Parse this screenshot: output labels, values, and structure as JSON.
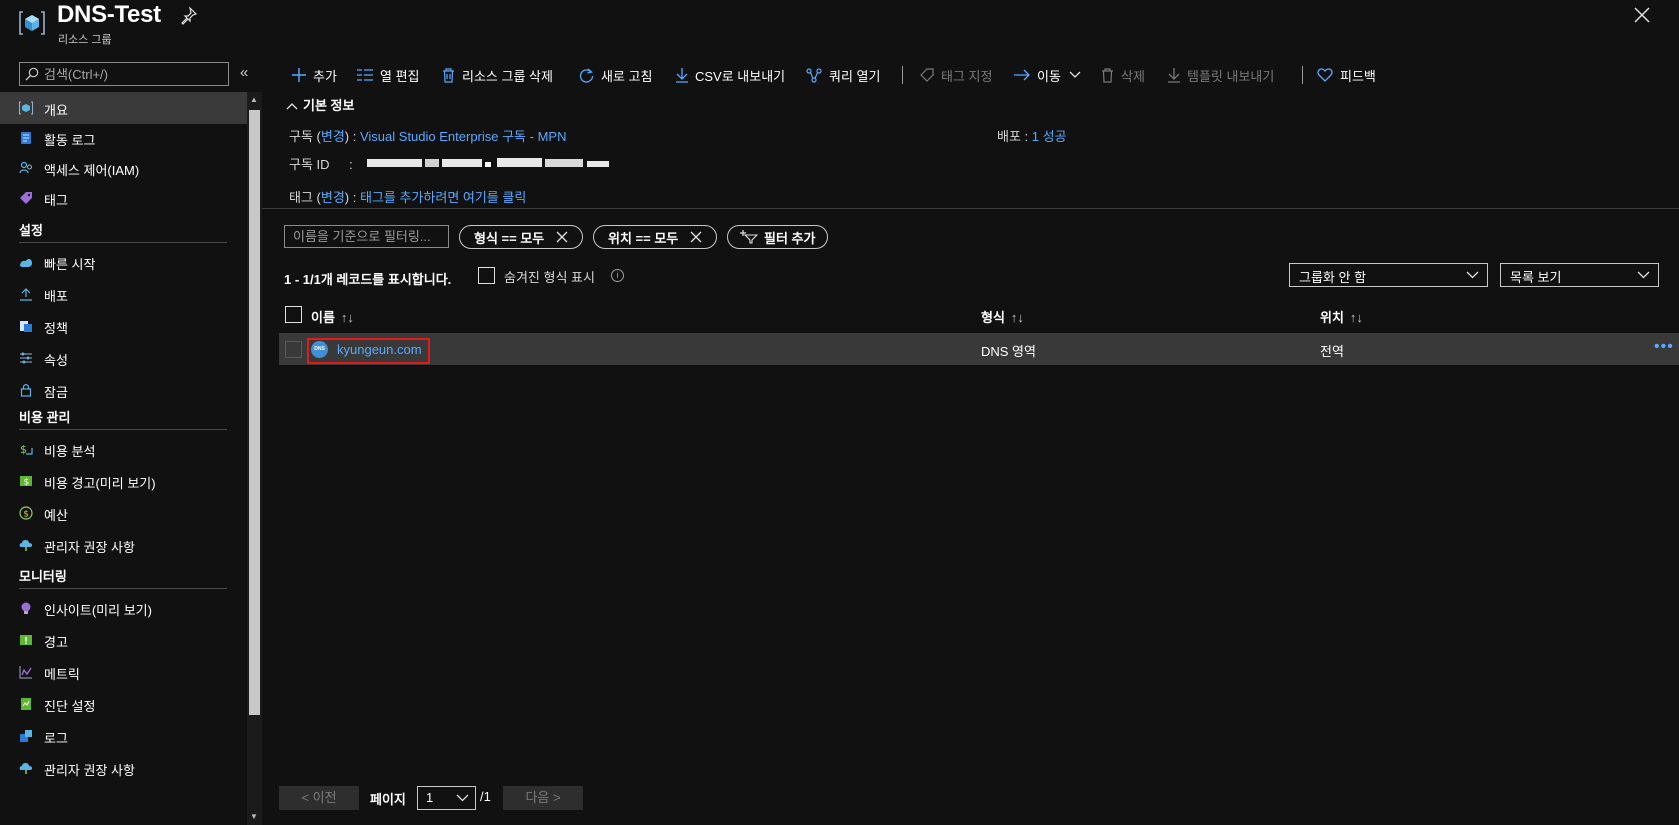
{
  "header": {
    "title": "DNS-Test",
    "subtitle": "리소스 그룹"
  },
  "sidebar": {
    "search_placeholder": "검색(Ctrl+/)",
    "collapse": "«",
    "items": [
      {
        "label": "개요",
        "icon": "resource-group-icon"
      },
      {
        "label": "활동 로그",
        "icon": "activity-log-icon"
      },
      {
        "label": "액세스 제어(IAM)",
        "icon": "iam-icon"
      },
      {
        "label": "태그",
        "icon": "tag-icon"
      }
    ],
    "sections": [
      {
        "title": "설정",
        "items": [
          {
            "label": "빠른 시작",
            "icon": "quickstart-icon"
          },
          {
            "label": "배포",
            "icon": "deploy-icon"
          },
          {
            "label": "정책",
            "icon": "policy-icon"
          },
          {
            "label": "속성",
            "icon": "properties-icon"
          },
          {
            "label": "잠금",
            "icon": "lock-icon"
          }
        ]
      },
      {
        "title": "비용 관리",
        "items": [
          {
            "label": "비용 분석",
            "icon": "cost-analysis-icon"
          },
          {
            "label": "비용 경고(미리 보기)",
            "icon": "cost-alert-icon"
          },
          {
            "label": "예산",
            "icon": "budget-icon"
          },
          {
            "label": "관리자 권장 사항",
            "icon": "advisor-icon"
          }
        ]
      },
      {
        "title": "모니터링",
        "items": [
          {
            "label": "인사이트(미리 보기)",
            "icon": "insights-icon"
          },
          {
            "label": "경고",
            "icon": "alert-icon"
          },
          {
            "label": "메트릭",
            "icon": "metrics-icon"
          },
          {
            "label": "진단 설정",
            "icon": "diagnostics-icon"
          },
          {
            "label": "로그",
            "icon": "logs-icon"
          },
          {
            "label": "관리자 권장 사항",
            "icon": "advisor-icon"
          }
        ]
      }
    ]
  },
  "toolbar": {
    "add": "추가",
    "edit_columns": "열 편집",
    "delete_group": "리소스 그룹 삭제",
    "refresh": "새로 고침",
    "export_csv": "CSV로 내보내기",
    "open_query": "쿼리 열기",
    "assign_tags": "태그 지정",
    "move": "이동",
    "delete": "삭제",
    "export_template": "템플릿 내보내기",
    "feedback": "피드백"
  },
  "essentials": {
    "toggle_label": "기본 정보",
    "subscription_label": "구독 (",
    "subscription_change": "변경",
    "subscription_sep": ") :",
    "subscription_value": "Visual Studio Enterprise 구독 - MPN",
    "subscription_id_label": "구독 ID",
    "subscription_id_sep": ":",
    "tags_label": "태그 (",
    "tags_change": "변경",
    "tags_sep": ") :",
    "tags_value": "태그를 추가하려면 여기를 클릭",
    "deploy_label": "배포 :",
    "deploy_value": "1 성공"
  },
  "filters": {
    "name_placeholder": "이름을 기준으로 필터링...",
    "type_pill": "형식 == 모두",
    "location_pill": "위치 == 모두",
    "add_filter": "필터 추가",
    "records_text": "1 - 1/1개 레코드를 표시합니다.",
    "show_hidden": "숨겨진 형식 표시",
    "grouping": "그룹화 안 함",
    "view_mode": "목록 보기"
  },
  "grid": {
    "columns": [
      {
        "label": "이름",
        "sort": "↑↓"
      },
      {
        "label": "형식",
        "sort": "↑↓"
      },
      {
        "label": "위치",
        "sort": "↑↓"
      }
    ],
    "rows": [
      {
        "name": "kyungeun.com",
        "type": "DNS 영역",
        "location": "전역",
        "icon_text": "DNS"
      }
    ]
  },
  "pager": {
    "prev": "< 이전",
    "page_label": "페이지",
    "page_value": "1",
    "page_total": "/1",
    "next": "다음 >"
  },
  "colors": {
    "accent_link": "#5aa9ff",
    "highlight_box": "#e3191c",
    "background": "#111111"
  }
}
